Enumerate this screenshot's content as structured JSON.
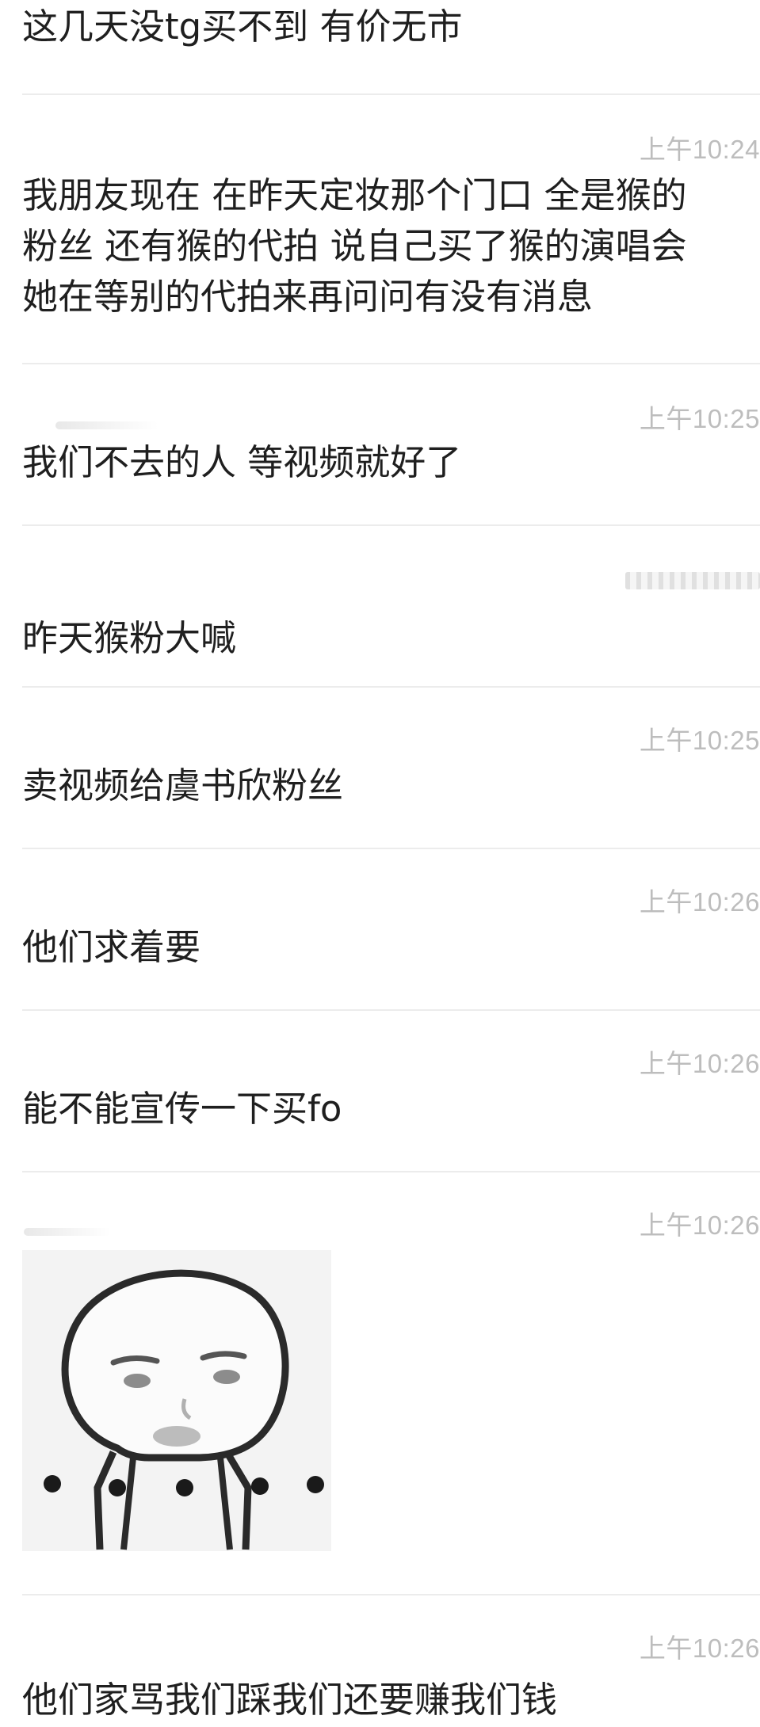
{
  "messages": [
    {
      "time": "",
      "text": "这几天没tg买不到 有价无市"
    },
    {
      "time": "上午10:24",
      "text": "我朋友现在 在昨天定妆那个门口 全是猴的\n粉丝 还有猴的代拍 说自己买了猴的演唱会\n她在等别的代拍来再问问有没有消息"
    },
    {
      "time": "上午10:25",
      "text": "我们不去的人 等视频就好了"
    },
    {
      "time": "",
      "text": "昨天猴粉大喊"
    },
    {
      "time": "上午10:25",
      "text": "卖视频给虞书欣粉丝"
    },
    {
      "time": "上午10:26",
      "text": "他们求着要"
    },
    {
      "time": "上午10:26",
      "text": "能不能宣传一下买fo"
    },
    {
      "time": "上午10:26",
      "sticker": "cartoon-face-sticker"
    },
    {
      "time": "上午10:26",
      "text": "他们家骂我们踩我们还要赚我们钱"
    }
  ],
  "colors": {
    "background": "#ffffff",
    "text": "#1f1f1f",
    "timestamp": "#bdbdbd",
    "divider": "#ececec"
  }
}
